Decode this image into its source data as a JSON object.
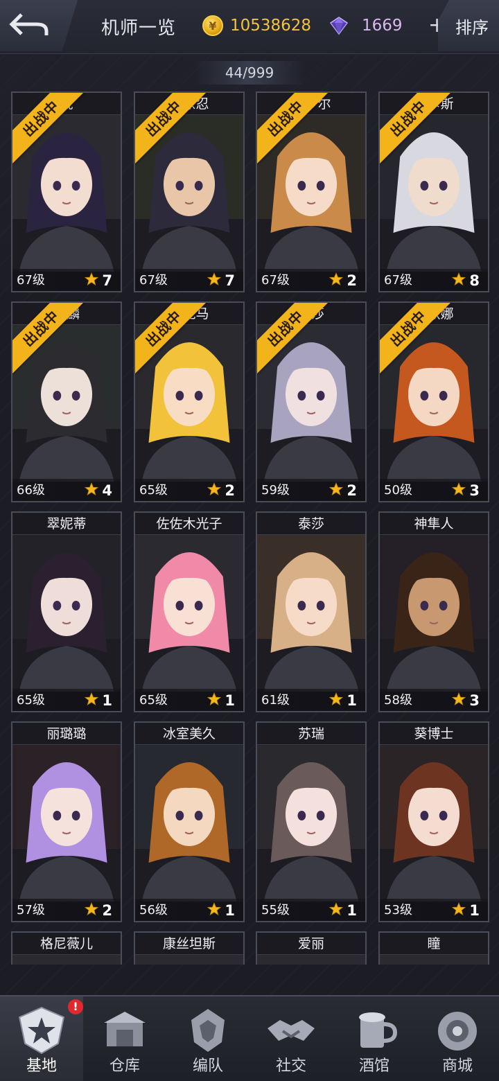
{
  "header": {
    "title": "机师一览",
    "gold": "10538628",
    "gems": "1669",
    "plus": "+",
    "sort_label": "排序",
    "coin_symbol": "¥"
  },
  "count": "44/999",
  "ribbon_text": "出战中",
  "pilots": [
    {
      "name": "胧",
      "level": "67级",
      "stars": "7",
      "deployed": true,
      "hair": "#2b2440",
      "skin": "#f3dcd0",
      "bg": "#2a2a30"
    },
    {
      "name": "藤原忍",
      "level": "67级",
      "stars": "7",
      "deployed": true,
      "hair": "#2d2a3c",
      "skin": "#e9c6a8",
      "bg": "#2a2c26"
    },
    {
      "name": "茱萝尔",
      "level": "67级",
      "stars": "2",
      "deployed": true,
      "hair": "#c98a4a",
      "skin": "#f6dcc8",
      "bg": "#2e2a26"
    },
    {
      "name": "奥卡斯",
      "level": "67级",
      "stars": "8",
      "deployed": true,
      "hair": "#d8d8e0",
      "skin": "#f0dccc",
      "bg": "#26272e"
    },
    {
      "name": "影麟",
      "level": "66级",
      "stars": "4",
      "deployed": true,
      "hair": "#2c2c30",
      "skin": "#ece0d8",
      "bg": "#2a2d2e"
    },
    {
      "name": "乔龙马",
      "level": "65级",
      "stars": "2",
      "deployed": true,
      "hair": "#f2c23a",
      "skin": "#f8dcc4",
      "bg": "#2a2a2e"
    },
    {
      "name": "妮莎",
      "level": "59级",
      "stars": "2",
      "deployed": true,
      "hair": "#a8a4c0",
      "skin": "#f0e0e0",
      "bg": "#2b2b33"
    },
    {
      "name": "萨欧娜",
      "level": "50级",
      "stars": "3",
      "deployed": true,
      "hair": "#c4581e",
      "skin": "#f4d8c4",
      "bg": "#26282e"
    },
    {
      "name": "翠妮蒂",
      "level": "65级",
      "stars": "1",
      "deployed": false,
      "hair": "#2a2030",
      "skin": "#eeddd8",
      "bg": "#222228"
    },
    {
      "name": "佐佐木光子",
      "level": "65级",
      "stars": "1",
      "deployed": false,
      "hair": "#f08aa8",
      "skin": "#f8e0d4",
      "bg": "#2a2a30"
    },
    {
      "name": "泰莎",
      "level": "61级",
      "stars": "1",
      "deployed": false,
      "hair": "#d8b088",
      "skin": "#f6dcc8",
      "bg": "#3a2e28"
    },
    {
      "name": "神隼人",
      "level": "58级",
      "stars": "3",
      "deployed": false,
      "hair": "#3a2418",
      "skin": "#c89870",
      "bg": "#252028"
    },
    {
      "name": "丽璐璐",
      "level": "57级",
      "stars": "2",
      "deployed": false,
      "hair": "#b090e0",
      "skin": "#f6e2dc",
      "bg": "#2b2228"
    },
    {
      "name": "冰室美久",
      "level": "56级",
      "stars": "1",
      "deployed": false,
      "hair": "#b06828",
      "skin": "#f4d8c0",
      "bg": "#262a30"
    },
    {
      "name": "苏瑞",
      "level": "55级",
      "stars": "1",
      "deployed": false,
      "hair": "#6a5a5a",
      "skin": "#f4e0dc",
      "bg": "#2a2a2e"
    },
    {
      "name": "葵博士",
      "level": "53级",
      "stars": "1",
      "deployed": false,
      "hair": "#6e3422",
      "skin": "#f4dcd0",
      "bg": "#2a2426"
    },
    {
      "name": "格尼薇儿",
      "level": "",
      "stars": "",
      "deployed": false,
      "hair": "#e08a78",
      "skin": "#f4dcd0",
      "bg": "#2a2a30"
    },
    {
      "name": "康丝坦斯",
      "level": "",
      "stars": "",
      "deployed": false,
      "hair": "#7a5a30",
      "skin": "#f4dcd0",
      "bg": "#2a2a30"
    },
    {
      "name": "爱丽",
      "level": "",
      "stars": "",
      "deployed": false,
      "hair": "#e0b890",
      "skin": "#f4dcd0",
      "bg": "#2a2a30"
    },
    {
      "name": "瞳",
      "level": "",
      "stars": "",
      "deployed": false,
      "hair": "#3a3040",
      "skin": "#f4dcd0",
      "bg": "#2a2a30"
    }
  ],
  "nav": [
    {
      "label": "基地",
      "icon": "base-emblem-icon",
      "active": true,
      "badge": "!"
    },
    {
      "label": "仓库",
      "icon": "warehouse-icon",
      "active": false,
      "badge": ""
    },
    {
      "label": "编队",
      "icon": "formation-icon",
      "active": false,
      "badge": ""
    },
    {
      "label": "社交",
      "icon": "handshake-icon",
      "active": false,
      "badge": ""
    },
    {
      "label": "酒馆",
      "icon": "tavern-mug-icon",
      "active": false,
      "badge": ""
    },
    {
      "label": "商城",
      "icon": "shop-icon",
      "active": false,
      "badge": ""
    }
  ]
}
